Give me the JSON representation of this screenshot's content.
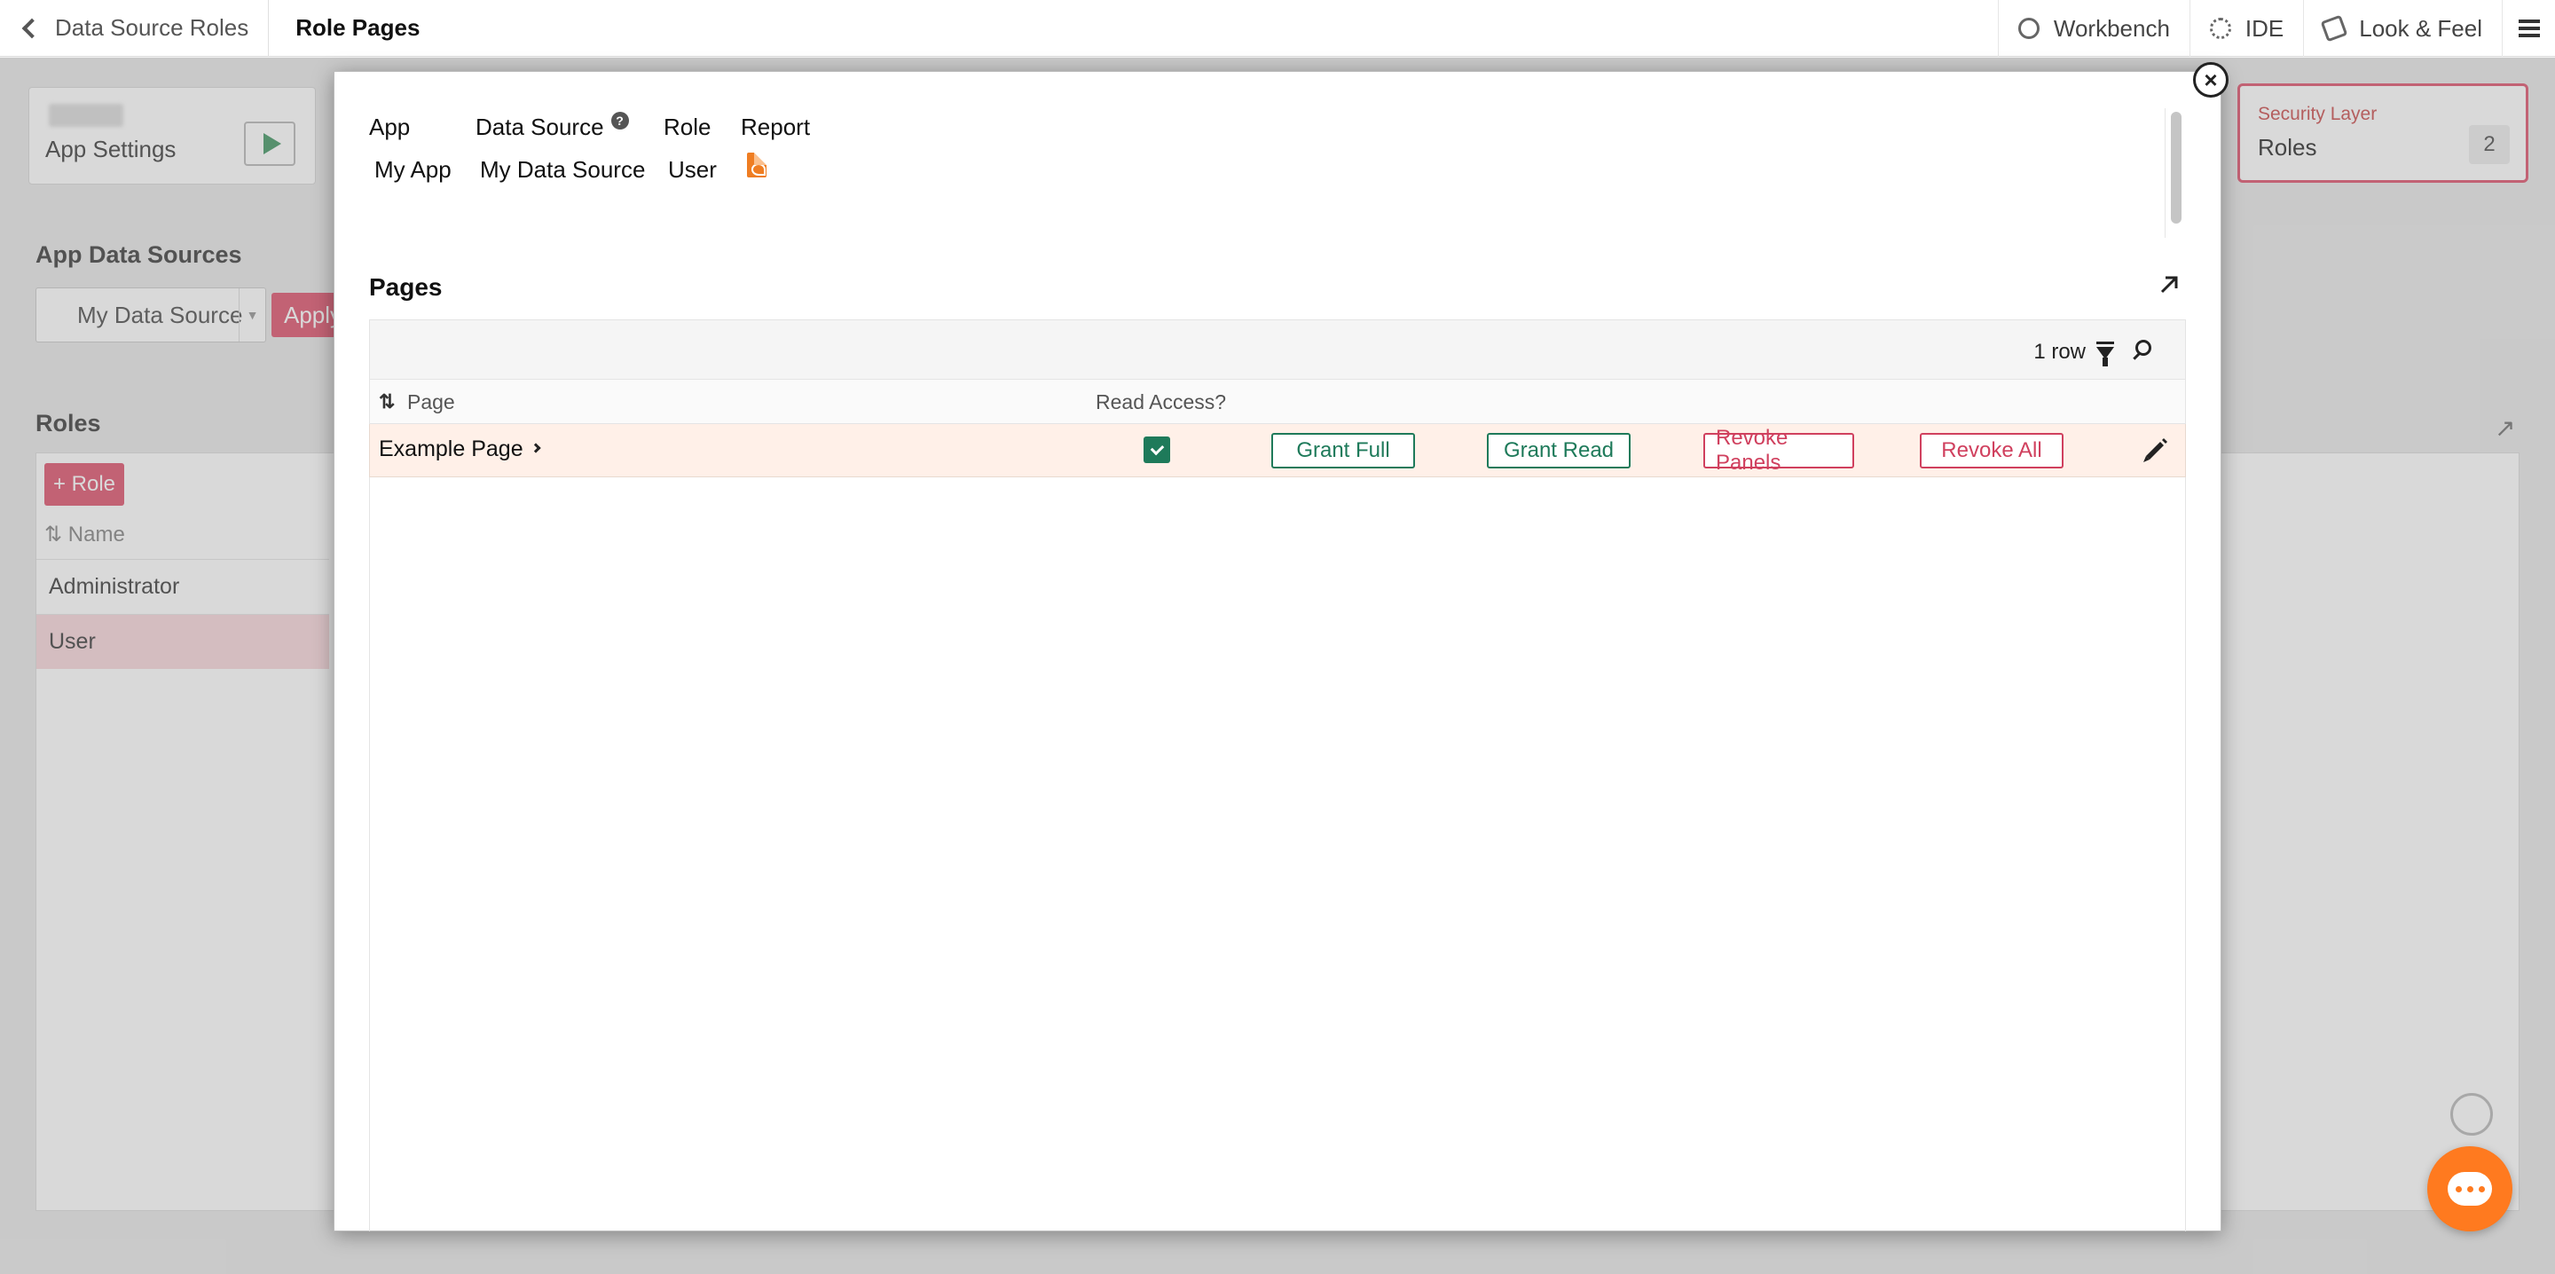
{
  "topbar": {
    "back_label": "Data Source Roles",
    "page_title": "Role Pages",
    "items": [
      {
        "label": "Workbench",
        "icon": "workbench-icon"
      },
      {
        "label": "IDE",
        "icon": "gear-icon"
      },
      {
        "label": "Look & Feel",
        "icon": "brush-icon"
      }
    ],
    "menu_icon": "hamburger-icon"
  },
  "background": {
    "app_card_label": "App Settings",
    "security_card": {
      "kicker": "Security Layer",
      "title": "Roles",
      "count": "2"
    },
    "app_data_sources_title": "App Data Sources",
    "data_source_select": "My Data Source",
    "apply_label": "Apply",
    "roles_title": "Roles",
    "add_role_label": "+ Role",
    "roles_column": "Name",
    "roles": [
      "Administrator",
      "User"
    ]
  },
  "modal": {
    "context_headers": {
      "app": "App",
      "data_source": "Data Source",
      "role": "Role",
      "report": "Report"
    },
    "context_values": {
      "app": "My App",
      "data_source": "My Data Source",
      "role": "User"
    },
    "pages_title": "Pages",
    "row_count": "1 row",
    "columns": {
      "page": "Page",
      "read_access": "Read Access?"
    },
    "rows": [
      {
        "page": "Example Page",
        "read_access": true,
        "buttons": {
          "grant_full": "Grant Full",
          "grant_read": "Grant Read",
          "revoke_panels": "Revoke Panels",
          "revoke_all": "Revoke All"
        }
      }
    ],
    "close_symbol": "×",
    "help_symbol": "?"
  },
  "colors": {
    "accent_red": "#d0405e",
    "accent_green": "#1e7a5a",
    "row_highlight": "#fff0e8",
    "chat_orange": "#ff7a1f"
  }
}
